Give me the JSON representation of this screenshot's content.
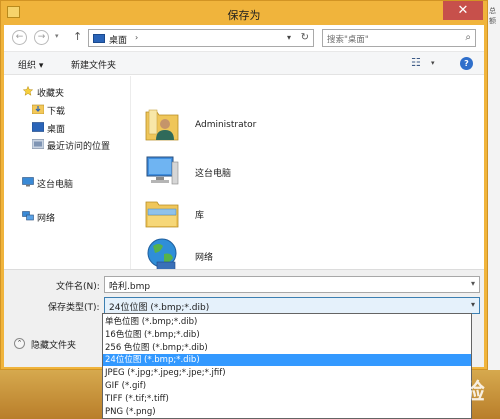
{
  "window": {
    "title": "保存为",
    "close_glyph": "✕"
  },
  "navigation": {
    "back_glyph": "←",
    "forward_glyph": "→",
    "up_glyph": "↑",
    "recent_glyph": "▾",
    "address": "桌面",
    "address_separator": "›",
    "address_dropdown": "▾",
    "refresh_glyph": "↻",
    "search_placeholder": "搜索\"桌面\"",
    "search_glyph": "⌕"
  },
  "toolbar": {
    "organize": "组织 ▾",
    "new_folder": "新建文件夹",
    "view_glyph": "☷",
    "view_dropdown": "▾",
    "help": "?"
  },
  "sidebar": {
    "items": [
      {
        "label": "收藏夹",
        "icon": "star-icon"
      },
      {
        "label": "下载",
        "icon": "download-folder-icon"
      },
      {
        "label": "桌面",
        "icon": "desktop-icon"
      },
      {
        "label": "最近访问的位置",
        "icon": "recent-places-icon"
      },
      {
        "label": "这台电脑",
        "icon": "computer-icon"
      },
      {
        "label": "网络",
        "icon": "network-icon"
      }
    ]
  },
  "content": {
    "items": [
      {
        "label": "Administrator",
        "icon": "user-folder-icon"
      },
      {
        "label": "这台电脑",
        "icon": "computer-icon"
      },
      {
        "label": "库",
        "icon": "library-icon"
      },
      {
        "label": "网络",
        "icon": "network-globe-icon"
      }
    ]
  },
  "save": {
    "filename_label": "文件名(N):",
    "filename_value": "哈利.bmp",
    "type_label": "保存类型(T):",
    "type_value": "24位位图 (*.bmp;*.dib)",
    "dropdown_glyph": "▾",
    "hide_folders": "隐藏文件夹",
    "hide_glyph": "⌃"
  },
  "file_types": [
    "单色位图 (*.bmp;*.dib)",
    "16色位图 (*.bmp;*.dib)",
    "256 色位图 (*.bmp;*.dib)",
    "24位位图 (*.bmp;*.dib)",
    "JPEG (*.jpg;*.jpeg;*.jpe;*.jfif)",
    "GIF (*.gif)",
    "TIFF (*.tif;*.tiff)",
    "PNG (*.png)"
  ],
  "selected_type_index": 3,
  "background": {
    "right_text": "总额"
  },
  "watermark": "Baidu经验",
  "colors": {
    "selection": "#3399ff",
    "title_bar": "#f0b43c",
    "close": "#c7504b"
  }
}
